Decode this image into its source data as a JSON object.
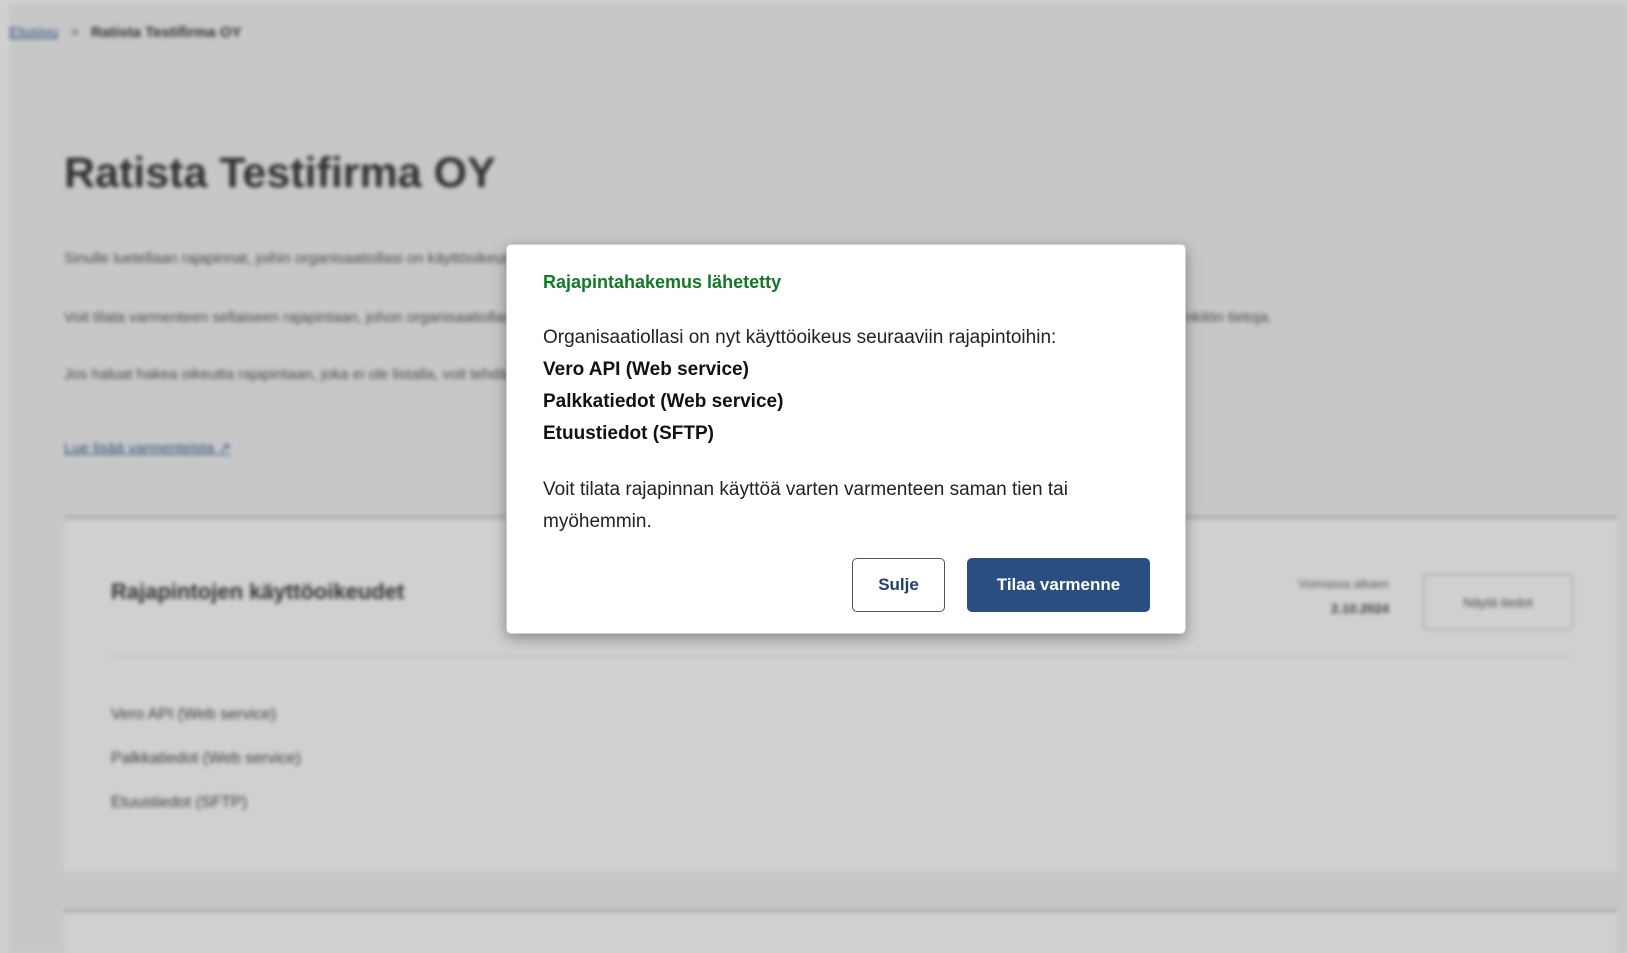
{
  "background_page": {
    "breadcrumb": {
      "parent": "Etusivu",
      "separator": ">",
      "current": "Ratista Testifirma OY"
    },
    "title": "Ratista Testifirma OY",
    "intro_lines": [
      "Sinulle luetellaan rajapinnat, joihin organisaatiollasi on käyttöoikeus.",
      "Voit tilata varmenteen sellaiseen rajapintaan, johon organisaatiollasi on käyttöoikeus. Voit myös muokata tai lisätä varmenteen tilaajaa sekä tarkastella teknisen yhteyshenkilön tietoja.",
      "Jos haluat hakea oikeutta rajapintaan, joka ei ole listalla, voit tehdä sen rajapintahakemuksella."
    ],
    "link_text": "Lue lisää varmenteista",
    "card": {
      "title": "Rajapintojen käyttöoikeudet",
      "valid_label": "Voimassa alkaen",
      "valid_date": "2.10.2024",
      "button_label": "Näytä tiedot",
      "apis": [
        "Vero API (Web service)",
        "Palkkatiedot (Web service)",
        "Etuustiedot (SFTP)"
      ]
    }
  },
  "dialog": {
    "title": "Rajapintahakemus lähetetty",
    "title_color": "#117a24",
    "lead": "Organisaatiollasi on nyt käyttöoikeus seuraaviin rajapintoihin:",
    "apis": [
      "Vero API (Web service)",
      "Palkkatiedot (Web service)",
      "Etuustiedot (SFTP)"
    ],
    "info": "Voit tilata rajapinnan käyttöä varten varmenteen saman tien tai myöhemmin.",
    "close_label": "Sulje",
    "order_label": "Tilaa varmenne",
    "primary_color": "#2b4e80"
  }
}
